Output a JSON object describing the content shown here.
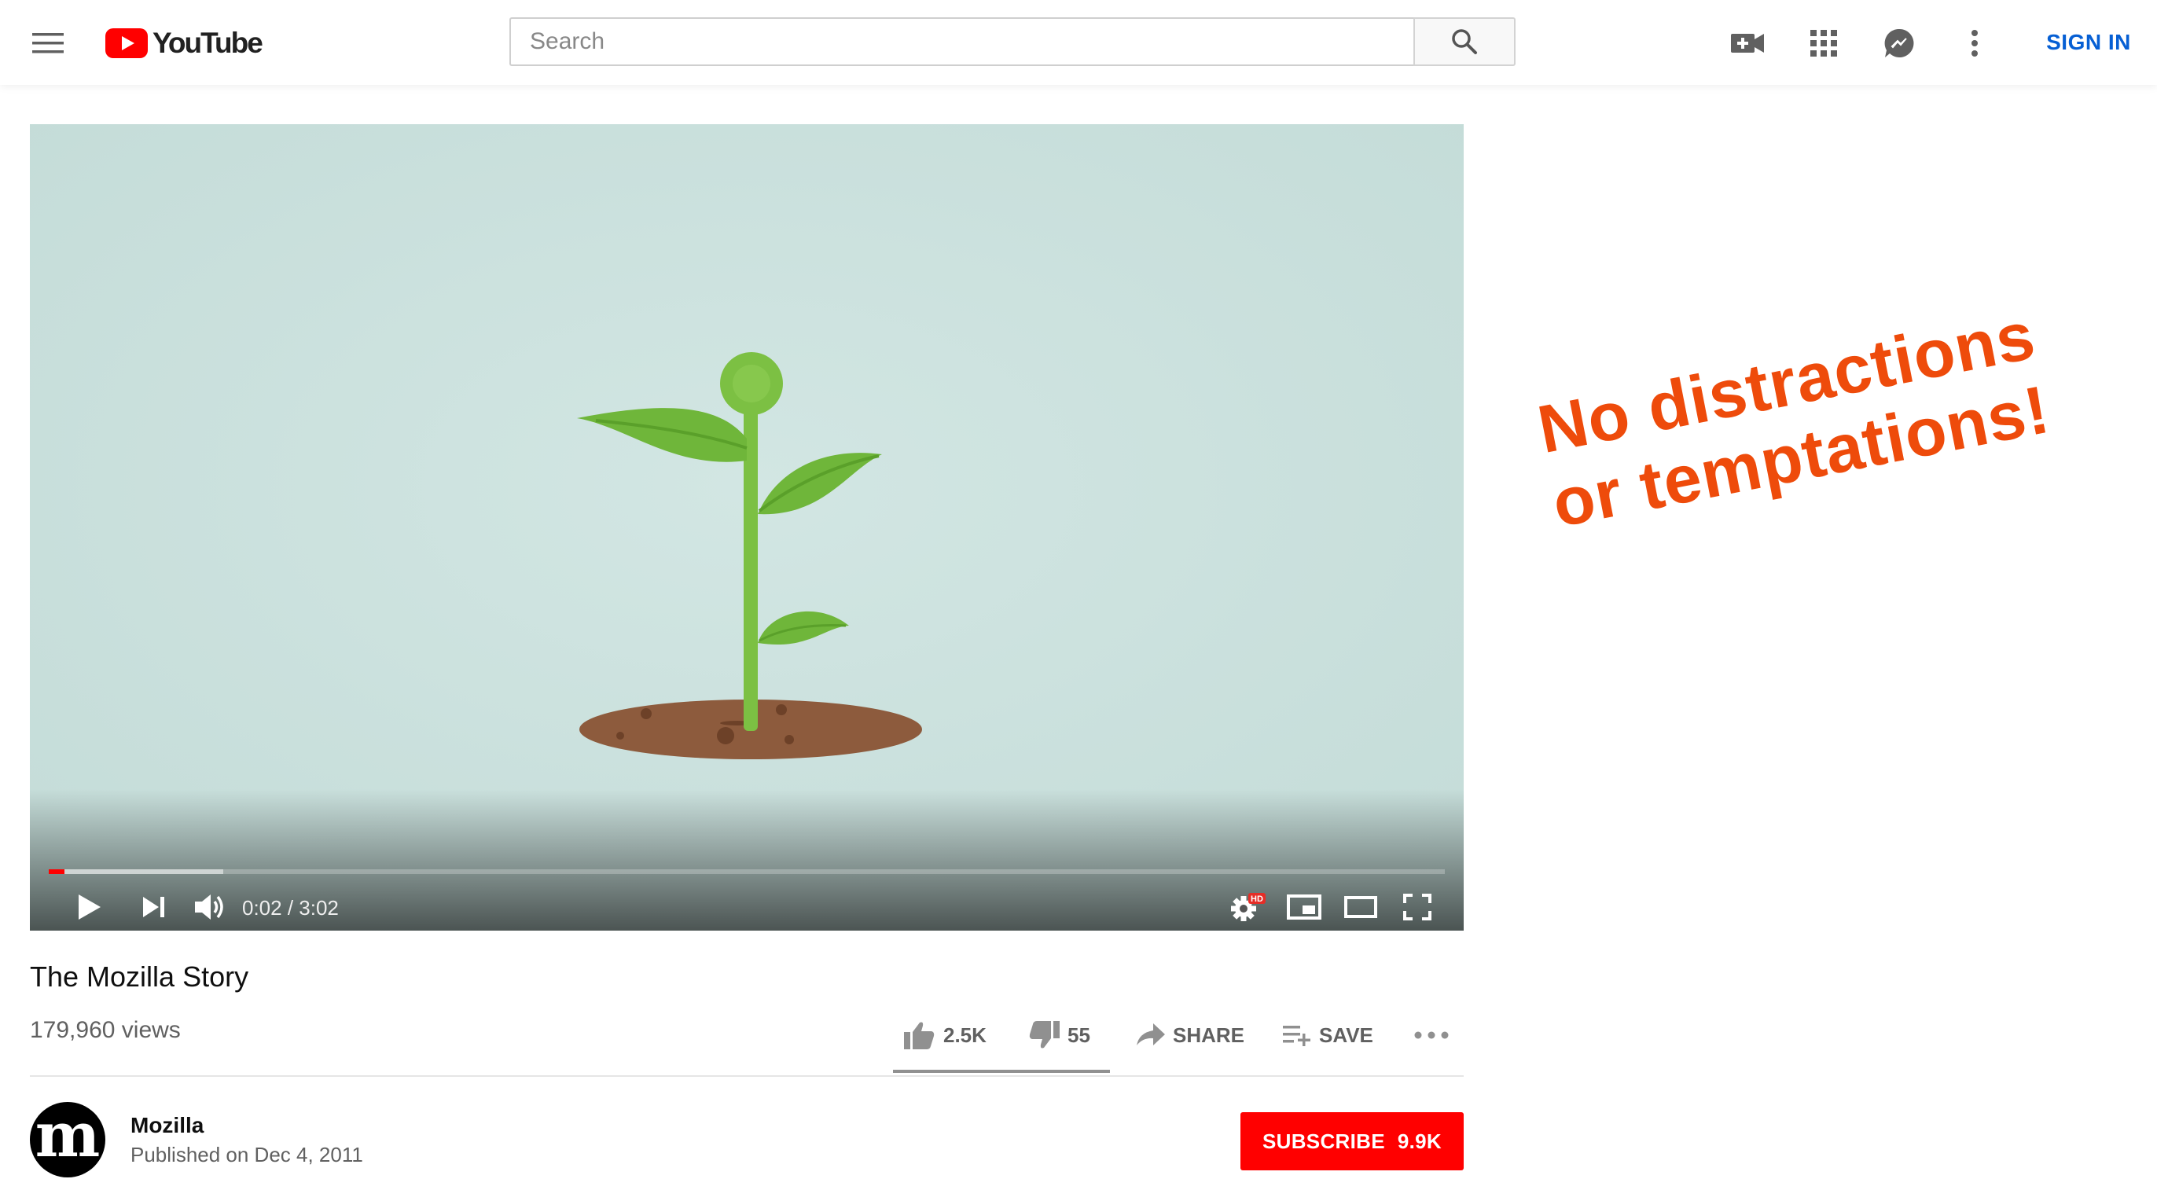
{
  "header": {
    "logo_text": "YouTube",
    "search_placeholder": "Search",
    "sign_in_label": "SIGN IN",
    "icons": [
      "menu-icon",
      "search-icon",
      "create-video-icon",
      "apps-grid-icon",
      "messages-icon",
      "more-vert-icon"
    ]
  },
  "player": {
    "current_time": "0:02",
    "duration": "3:02",
    "time_display": "0:02 / 3:02",
    "played_fraction": 0.011,
    "buffered_fraction": 0.125,
    "settings_badge": "HD",
    "icons": [
      "play-icon",
      "next-icon",
      "volume-icon",
      "settings-icon",
      "miniplayer-icon",
      "theater-mode-icon",
      "fullscreen-icon"
    ]
  },
  "video": {
    "title": "The Mozilla Story",
    "views": "179,960 views",
    "likes": "2.5K",
    "dislikes": "55",
    "share_label": "SHARE",
    "save_label": "SAVE",
    "like_ratio": 0.978
  },
  "channel": {
    "avatar_letter": "m",
    "name": "Mozilla",
    "published": "Published on Dec 4, 2011",
    "subscribe_label": "SUBSCRIBE",
    "subscriber_count": "9.9K"
  },
  "annotation": {
    "line1": "No distractions",
    "line2": "or temptations!",
    "color": "#ee4b0b"
  },
  "colors": {
    "brand_red": "#ff0000",
    "link_blue": "#065fd4",
    "player_background": "#cde2df"
  }
}
